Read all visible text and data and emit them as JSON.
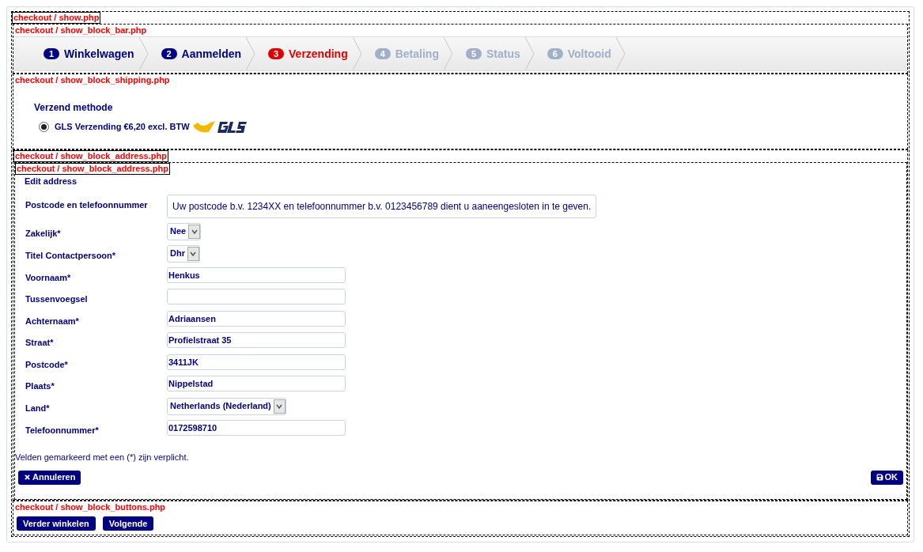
{
  "blocks": {
    "outer": {
      "label": "checkout / show.php",
      "framed": true
    },
    "bar": {
      "label": "checkout / show_block_bar.php",
      "framed": false
    },
    "shipping": {
      "label": "checkout / show_block_shipping.php",
      "framed": false
    },
    "address_outer": {
      "label": "checkout / show_block_address.php",
      "framed": true
    },
    "address_inner": {
      "label": "checkout / show_block_address.php",
      "framed": true
    },
    "buttons": {
      "label": "checkout / show_block_buttons.php",
      "framed": false
    }
  },
  "steps": [
    {
      "number": "1",
      "label": "Winkelwagen",
      "kind": "done"
    },
    {
      "number": "2",
      "label": "Aanmelden",
      "kind": "done"
    },
    {
      "number": "3",
      "label": "Verzending",
      "kind": "current"
    },
    {
      "number": "4",
      "label": "Betaling",
      "kind": "todo"
    },
    {
      "number": "5",
      "label": "Status",
      "kind": "todo"
    },
    {
      "number": "6",
      "label": "Voltooid",
      "kind": "todo"
    }
  ],
  "shipping": {
    "heading": "Verzend methode",
    "options": [
      {
        "label": "GLS Verzending €6,20 excl. BTW",
        "selected": true
      }
    ]
  },
  "address": {
    "title": "Edit address",
    "fields": [
      {
        "label": "Postcode en telefoonnummer",
        "kind": "note",
        "value": "Uw postcode b.v. 1234XX en telefoonnummer b.v. 0123456789 dient u aaneengesloten in te geven."
      },
      {
        "label": "Zakelijk*",
        "kind": "select",
        "value": "Nee"
      },
      {
        "label": "Titel Contactpersoon*",
        "kind": "select",
        "value": "Dhr"
      },
      {
        "label": "Voornaam*",
        "kind": "text",
        "value": "Henkus"
      },
      {
        "label": "Tussenvoegsel",
        "kind": "text"
      },
      {
        "label": "Achternaam*",
        "kind": "text",
        "value": "Adriaansen"
      },
      {
        "label": "Straat*",
        "kind": "text",
        "value": "Profielstraat 35"
      },
      {
        "label": "Postcode*",
        "kind": "text",
        "value": "3411JK"
      },
      {
        "label": "Plaats*",
        "kind": "text",
        "value": "Nippelstad"
      },
      {
        "label": "Land*",
        "kind": "select",
        "value": "Netherlands (Nederland)"
      },
      {
        "label": "Telefoonnummer*",
        "kind": "text",
        "value": "0172598710"
      }
    ],
    "required_note": "Velden gemarkeerd met een (*) zijn verplicht.",
    "cancel": "Annuleren",
    "ok": "OK"
  },
  "buttons": [
    "Verder winkelen",
    "Volgende"
  ]
}
